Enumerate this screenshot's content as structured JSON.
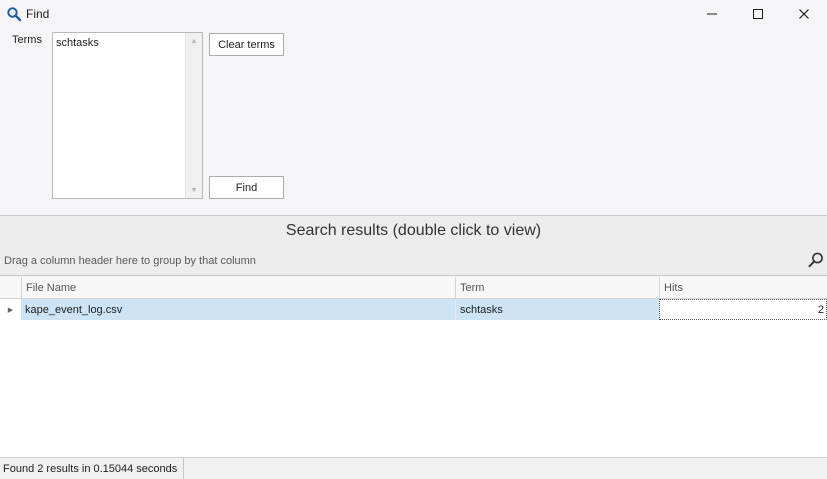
{
  "window": {
    "title": "Find",
    "icon": "search-icon",
    "controls": [
      "minimize-icon",
      "maximize-icon",
      "close-icon"
    ]
  },
  "terms": {
    "label": "Terms",
    "value": "schtasks",
    "clear_button": "Clear terms",
    "find_button": "Find"
  },
  "results": {
    "header": "Search results (double click to view)",
    "group_hint": "Drag a column header here to group by that column",
    "columns": [
      "File Name",
      "Term",
      "Hits"
    ],
    "rows": [
      {
        "file_name": "kape_event_log.csv",
        "term": "schtasks",
        "hits": "2"
      }
    ]
  },
  "status": {
    "text": "Found 2 results in 0.15044 seconds"
  },
  "colors": {
    "selected_row": "#cde4f7",
    "background": "#f5f4f6"
  }
}
